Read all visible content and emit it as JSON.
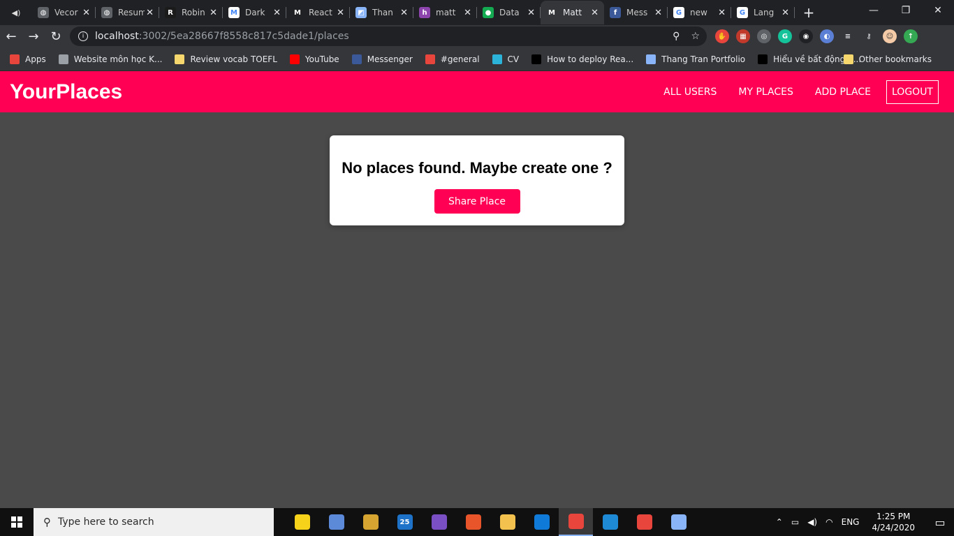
{
  "browser": {
    "tabs": [
      {
        "title": "Vecor",
        "icon": "globe-icon",
        "color": "#5f6368",
        "glyph": "◍"
      },
      {
        "title": "Resum",
        "icon": "globe-icon",
        "color": "#5f6368",
        "glyph": "◍"
      },
      {
        "title": "Robin",
        "icon": "robinhood-icon",
        "color": "#1b1b1b",
        "glyph": "R"
      },
      {
        "title": "Dark",
        "icon": "medium-icon",
        "color": "#ffffff",
        "glyph": "M"
      },
      {
        "title": "React",
        "icon": "medium-icon",
        "color": "#202124",
        "glyph": "M"
      },
      {
        "title": "Than",
        "icon": "portfolio-icon",
        "color": "#8ab4f8",
        "glyph": "◩"
      },
      {
        "title": "matt",
        "icon": "hashnode-icon",
        "color": "#8e44ad",
        "glyph": "h"
      },
      {
        "title": "Data",
        "icon": "mongodb-icon",
        "color": "#13aa52",
        "glyph": "●"
      },
      {
        "title": "Matt",
        "icon": "medium-icon",
        "color": "#35363a",
        "glyph": "M"
      },
      {
        "title": "Mess",
        "icon": "facebook-icon",
        "color": "#3b5998",
        "glyph": "f"
      },
      {
        "title": "new",
        "icon": "google-icon",
        "color": "#ffffff",
        "glyph": "G"
      },
      {
        "title": "Lang",
        "icon": "google-icon",
        "color": "#ffffff",
        "glyph": "G"
      }
    ],
    "active_tab_index": 8,
    "url_host": "localhost",
    "url_path": ":3002/5ea28667f8558c817c5dade1/places",
    "bookmarks": [
      {
        "label": "Apps",
        "icon": "apps-grid-icon",
        "color": "#e8453c"
      },
      {
        "label": "Website môn học K...",
        "icon": "page-icon",
        "color": "#9aa0a6"
      },
      {
        "label": "Review vocab TOEFL",
        "icon": "folder-icon",
        "color": "#f5d76e"
      },
      {
        "label": "YouTube",
        "icon": "youtube-icon",
        "color": "#ff0000"
      },
      {
        "label": "Messenger",
        "icon": "facebook-icon",
        "color": "#3b5998"
      },
      {
        "label": "#general",
        "icon": "slack-icon",
        "color": "#e8453c"
      },
      {
        "label": "CV",
        "icon": "novoresume-icon",
        "color": "#2bb3d9"
      },
      {
        "label": "How to deploy Rea...",
        "icon": "dev-icon",
        "color": "#000000"
      },
      {
        "label": "Thang Tran Portfolio",
        "icon": "portfolio-icon",
        "color": "#8ab4f8"
      },
      {
        "label": "Hiểu về bất động b...",
        "icon": "medium-icon",
        "color": "#000000"
      }
    ],
    "other_bookmarks": "Other bookmarks"
  },
  "app": {
    "brand": "YourPlaces",
    "brand_color": "#ff0055",
    "nav": {
      "all_users": "ALL USERS",
      "my_places": "MY PLACES",
      "add_place": "ADD PLACE",
      "logout": "LOGOUT"
    },
    "empty_message": "No places found. Maybe create one ?",
    "share_button": "Share Place"
  },
  "taskbar": {
    "search_placeholder": "Type here to search",
    "apps": [
      {
        "icon": "sticky-notes-icon",
        "color": "#f7d21b"
      },
      {
        "icon": "paint-icon",
        "color": "#5c8ad8"
      },
      {
        "icon": "tools-icon",
        "color": "#d6a531"
      },
      {
        "icon": "mail-icon",
        "color": "#1e73c8",
        "badge": "25"
      },
      {
        "icon": "visual-studio-icon",
        "color": "#7a4fc4"
      },
      {
        "icon": "git-icon",
        "color": "#e8552b"
      },
      {
        "icon": "file-explorer-icon",
        "color": "#f2c14e"
      },
      {
        "icon": "edge-icon",
        "color": "#0f7ad8"
      },
      {
        "icon": "chrome-icon",
        "color": "#e8453c",
        "active": true
      },
      {
        "icon": "vscode-icon",
        "color": "#1e8ad6"
      },
      {
        "icon": "chrome-icon",
        "color": "#e8453c"
      },
      {
        "icon": "notepad-icon",
        "color": "#8ab4f8"
      }
    ],
    "language": "ENG",
    "time": "1:25 PM",
    "date": "4/24/2020"
  }
}
